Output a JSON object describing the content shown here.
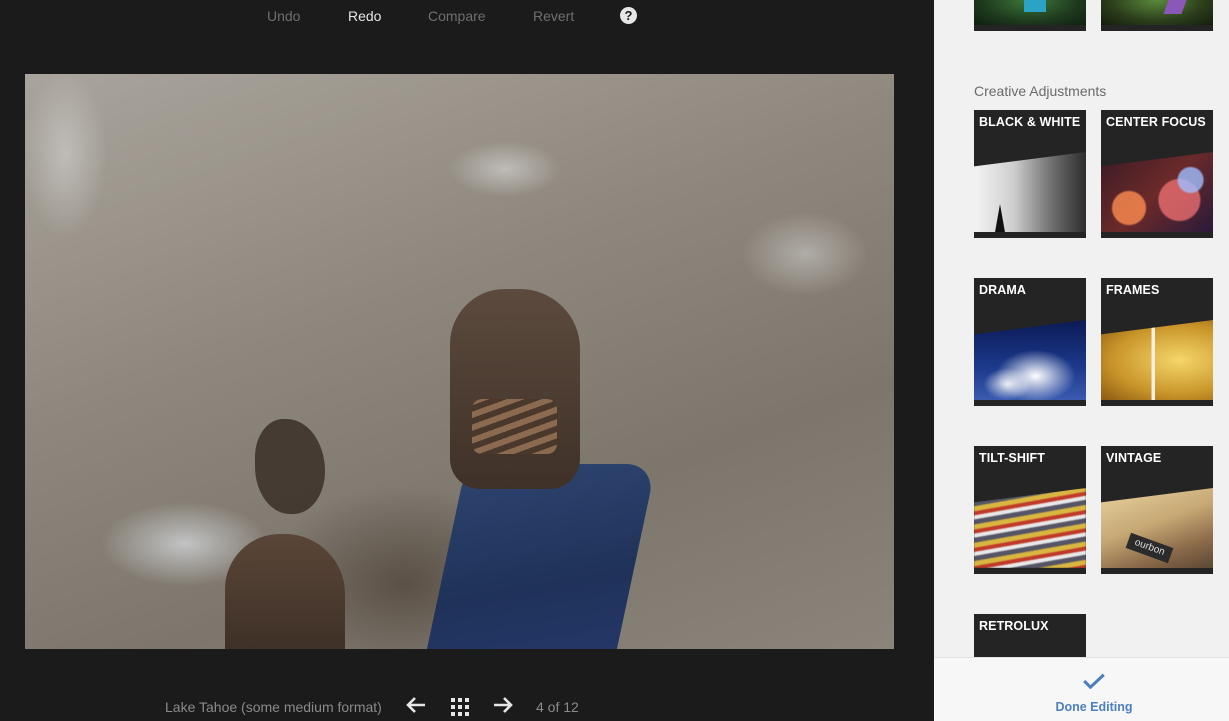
{
  "toolbar": {
    "undo_label": "Undo",
    "redo_label": "Redo",
    "compare_label": "Compare",
    "revert_label": "Revert",
    "help_label": "?"
  },
  "photo": {
    "caption": "Lake Tahoe (some medium format)",
    "counter": "4 of 12"
  },
  "navigation": {
    "prev_icon": "arrow-left-icon",
    "grid_icon": "grid-icon",
    "next_icon": "arrow-right-icon"
  },
  "sidebar": {
    "section_title": "Creative Adjustments",
    "tiles": [
      {
        "label": "BLACK & WHITE"
      },
      {
        "label": "CENTER FOCUS"
      },
      {
        "label": "DRAMA"
      },
      {
        "label": "FRAMES"
      },
      {
        "label": "TILT-SHIFT"
      },
      {
        "label": "VINTAGE"
      },
      {
        "label": "RETROLUX"
      }
    ],
    "vintage_sign_text": "ourbon",
    "done_label": "Done Editing"
  },
  "colors": {
    "accent": "#4a7fc0",
    "editor_bg": "#1b1b1b",
    "sidebar_bg": "#f1f1f1"
  }
}
